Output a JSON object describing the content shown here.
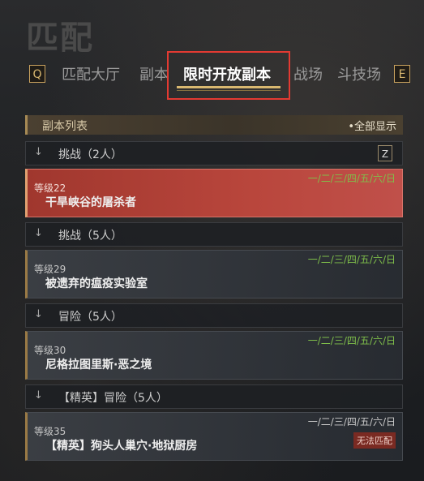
{
  "page_title": "匹配",
  "keys": {
    "left": "Q",
    "right": "E",
    "collapse": "Z"
  },
  "tabs": [
    {
      "label": "匹配大厅"
    },
    {
      "label": "副本"
    },
    {
      "label": "限时开放副本"
    },
    {
      "label": "战场"
    },
    {
      "label": "斗技场"
    }
  ],
  "list": {
    "header": "副本列表",
    "show_all": "•全部显示",
    "groups": [
      {
        "label": "挑战（2人）",
        "arrow": "↓"
      },
      {
        "label": "挑战（5人）",
        "arrow": "↓"
      },
      {
        "label": "冒险（5人）",
        "arrow": "↓"
      },
      {
        "label": "【精英】冒险（5人）",
        "arrow": "↓"
      }
    ],
    "cards": [
      {
        "level": "等级22",
        "name": "干旱峡谷的屠杀者",
        "days": "一/二/三/四/五/六/日"
      },
      {
        "level": "等级29",
        "name": "被遗弃的瘟疫实验室",
        "days": "一/二/三/四/五/六/日"
      },
      {
        "level": "等级30",
        "name": "尼格拉图里斯·恶之境",
        "days": "一/二/三/四/五/六/日"
      },
      {
        "level": "等级35",
        "name": "【精英】狗头人巢穴·地狱厨房",
        "days": "一/二/三/四/五/六/日",
        "badge": "无法匹配"
      }
    ]
  }
}
